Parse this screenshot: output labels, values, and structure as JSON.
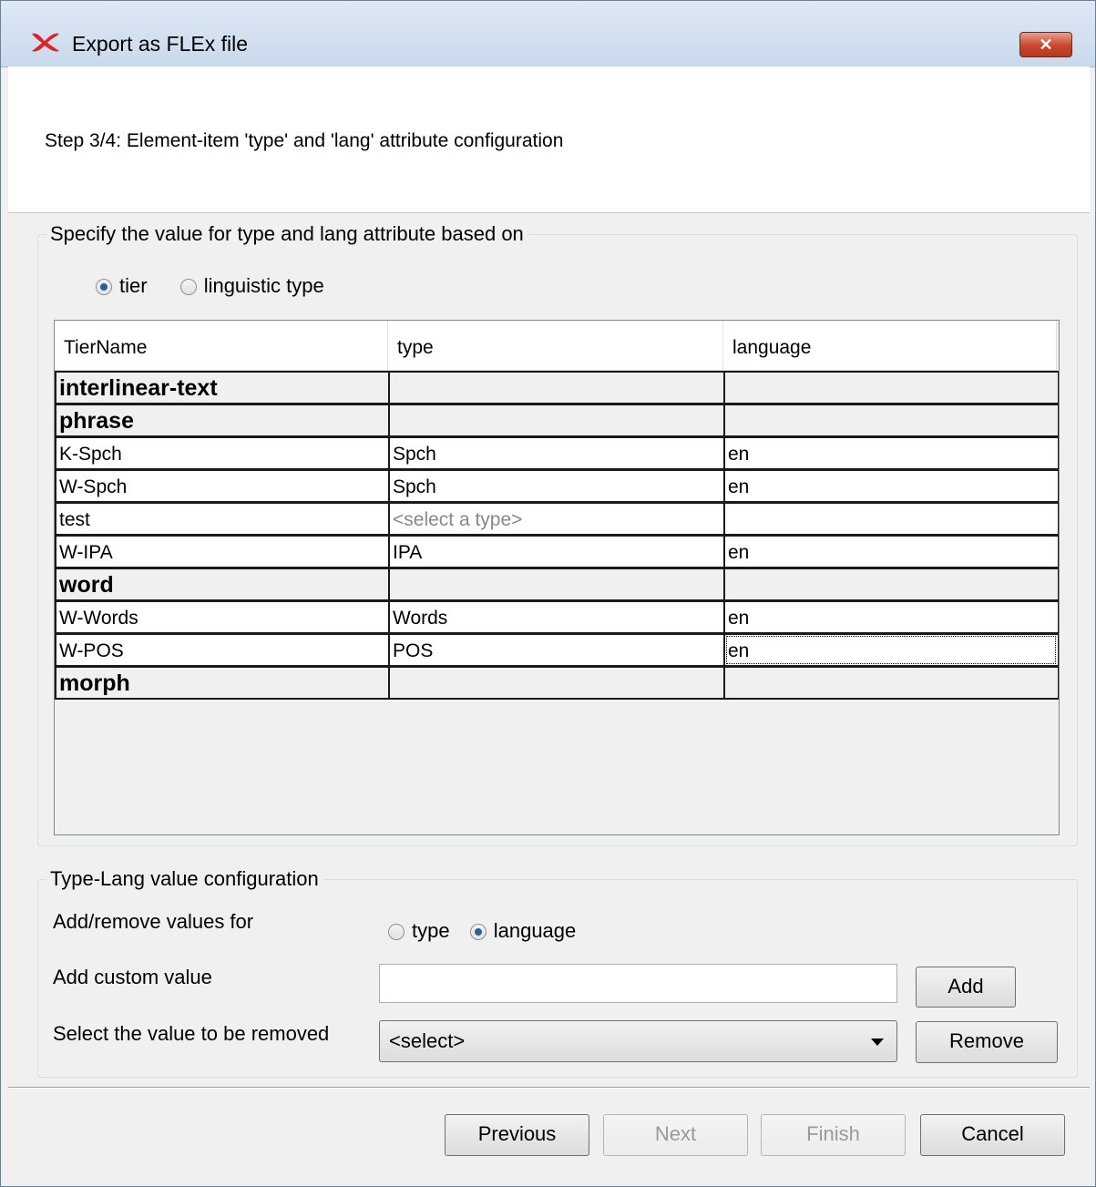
{
  "window": {
    "title": "Export as FLEx file",
    "close_label": "✕"
  },
  "step_label": "Step 3/4: Element-item 'type' and 'lang' attribute configuration",
  "basis_group": {
    "legend": "Specify the value for type and lang attribute based on",
    "options": [
      {
        "label": "tier",
        "checked": true
      },
      {
        "label": "linguistic type",
        "checked": false
      }
    ]
  },
  "table": {
    "columns": [
      "TierName",
      "type",
      "language"
    ],
    "rows": [
      {
        "tier": "interlinear-text",
        "type": "",
        "language": "",
        "group": true
      },
      {
        "tier": "phrase",
        "type": "",
        "language": "",
        "group": true
      },
      {
        "tier": "K-Spch",
        "type": "Spch",
        "language": "en",
        "group": false
      },
      {
        "tier": "W-Spch",
        "type": "Spch",
        "language": "en",
        "group": false
      },
      {
        "tier": "test",
        "type": "<select a type>",
        "language": "",
        "group": false,
        "placeholder": true
      },
      {
        "tier": "W-IPA",
        "type": "IPA",
        "language": "en",
        "group": false
      },
      {
        "tier": "word",
        "type": "",
        "language": "",
        "group": true
      },
      {
        "tier": "W-Words",
        "type": "Words",
        "language": "en",
        "group": false
      },
      {
        "tier": "W-POS",
        "type": "POS",
        "language": "en",
        "group": false,
        "focused": true
      },
      {
        "tier": "morph",
        "type": "",
        "language": "",
        "group": true
      }
    ]
  },
  "typelang_group": {
    "legend": "Type-Lang value configuration",
    "add_remove_label": "Add/remove values for",
    "options": [
      {
        "label": "type",
        "checked": false
      },
      {
        "label": "language",
        "checked": true
      }
    ],
    "custom_label": "Add custom value",
    "custom_value": "",
    "add_button": "Add",
    "remove_label": "Select the value to be removed",
    "remove_selected": "<select>",
    "remove_button": "Remove"
  },
  "footer": {
    "previous": "Previous",
    "next": "Next",
    "finish": "Finish",
    "cancel": "Cancel"
  }
}
